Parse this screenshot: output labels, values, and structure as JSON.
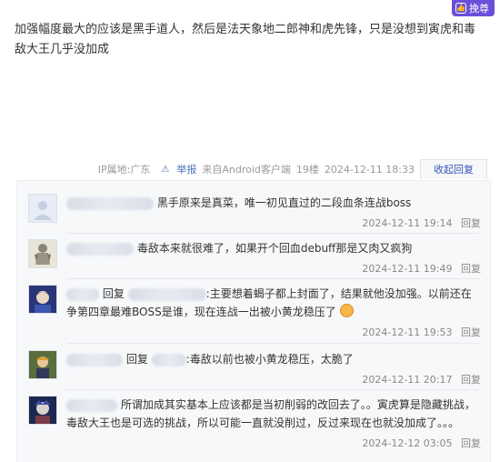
{
  "top_button": {
    "label": "挽尊"
  },
  "post": {
    "text": "加强幅度最大的应该是黑手道人，然后是法天象地二郎神和虎先锋，只是没想到寅虎和毒敌大王几乎没加成"
  },
  "meta": {
    "ip": "IP属地:广东",
    "report": "举报",
    "source": "来自Android客户端",
    "floor": "19楼",
    "datetime": "2024-12-11 18:33",
    "collapse": "收起回复"
  },
  "replies": [
    {
      "text": "黑手原来是真菜，唯一初见直过的二段血条连战boss",
      "time": "2024-12-11 19:14",
      "reply_label": "回复"
    },
    {
      "text": "毒敌本来就很难了，如果开个回血debuff那是又肉又疯狗",
      "time": "2024-12-11 19:49",
      "reply_label": "回复"
    },
    {
      "prefix": "回复",
      "colon": ":",
      "text": "主要想着蝎子都上封面了，结果就他没加强。以前还在争第四章最难BOSS是谁，现在连战一出被小黄龙稳压了",
      "time": "2024-12-11 19:53",
      "reply_label": "回复"
    },
    {
      "prefix": "回复",
      "colon": ":",
      "text": "毒敌以前也被小黄龙稳压，太脆了",
      "time": "2024-12-11 20:17",
      "reply_label": "回复"
    },
    {
      "text": "所谓加成其实基本上应该都是当初削弱的改回去了。。寅虎算是隐藏挑战，毒敌大王也是可选的挑战，所以可能一直就没削过，反过来现在也就没加成了。。。",
      "time": "2024-12-12 03:05",
      "reply_label": "回复"
    }
  ]
}
